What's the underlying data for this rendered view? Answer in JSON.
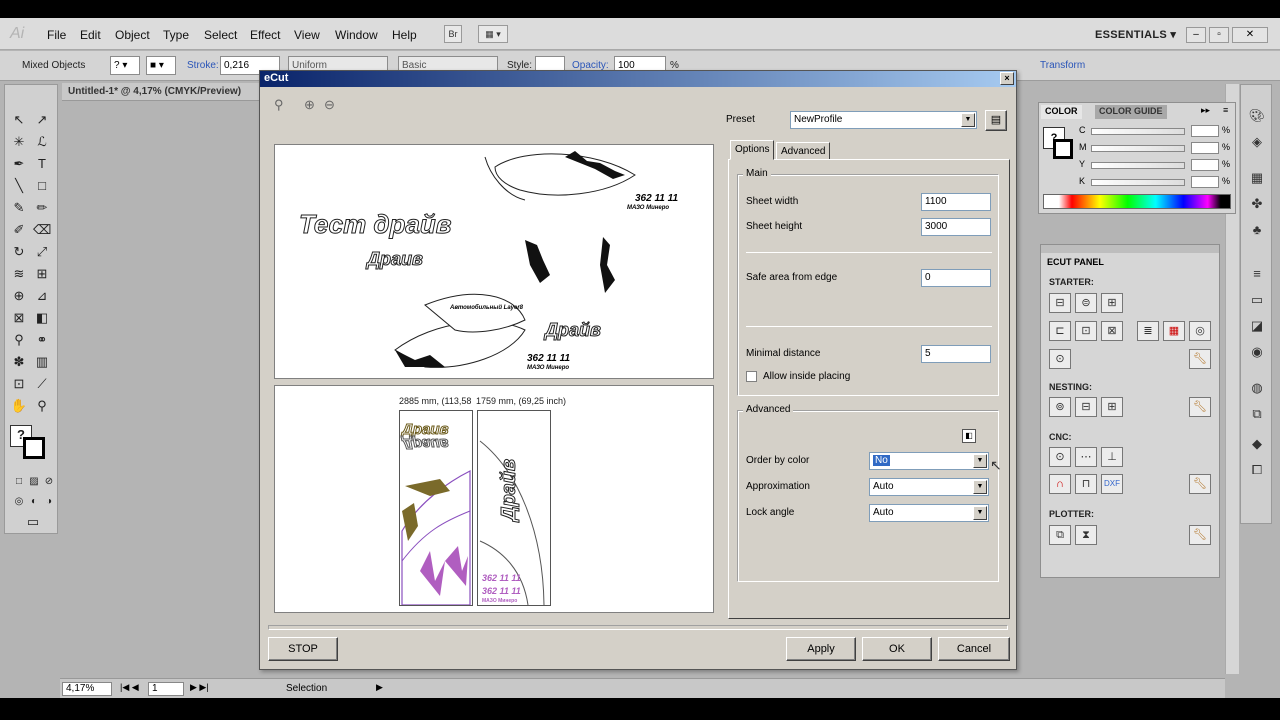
{
  "menubar": {
    "logo": "Ai",
    "items": [
      "File",
      "Edit",
      "Object",
      "Type",
      "Select",
      "Effect",
      "View",
      "Window",
      "Help"
    ],
    "bridge_label": "Br",
    "workspace": "ESSENTIALS"
  },
  "controlbar": {
    "selection": "Mixed Objects",
    "stroke_label": "Stroke:",
    "stroke_value": "0,216",
    "uniform_label": "Uniform",
    "basic_label": "Basic",
    "style_label": "Style:",
    "opacity_label": "Opacity:",
    "opacity_value": "100",
    "opacity_unit": "%",
    "transform_label": "Transform"
  },
  "document": {
    "tab_title": "Untitled-1* @ 4,17% (CMYK/Preview)"
  },
  "statusbar": {
    "zoom": "4,17%",
    "artboard": "1",
    "mode": "Selection"
  },
  "color_panel": {
    "tab_color": "COLOR",
    "tab_guide": "COLOR GUIDE",
    "channels": [
      "C",
      "M",
      "Y",
      "K"
    ],
    "percent": "%"
  },
  "ecut_panel": {
    "title": "ECUT PANEL",
    "starter": "STARTER:",
    "nesting": "NESTING:",
    "cnc": "CNC:",
    "plotter": "PLOTTER:"
  },
  "dialog": {
    "title": "eCut",
    "close": "×",
    "preset_label": "Preset",
    "preset_value": "NewProfile",
    "tabs": [
      "Options",
      "Advanced"
    ],
    "main_group": "Main",
    "sheet_width_label": "Sheet width",
    "sheet_width": "1100",
    "sheet_height_label": "Sheet height",
    "sheet_height": "3000",
    "safe_area_label": "Safe area from edge",
    "safe_area": "0",
    "min_distance_label": "Minimal distance",
    "min_distance": "5",
    "allow_inside_label": "Allow inside placing",
    "advanced_group": "Advanced",
    "order_by_color_label": "Order by color",
    "order_by_color": "No",
    "approximation_label": "Approximation",
    "approximation": "Auto",
    "lock_angle_label": "Lock angle",
    "lock_angle": "Auto",
    "stop": "STOP",
    "apply": "Apply",
    "ok": "OK",
    "cancel": "Cancel",
    "sheet1_dim": "2885 mm, (113,58",
    "sheet2_dim": "1759 mm, (69,25 inch)"
  },
  "artwork": {
    "text1": "Тест драйв",
    "text2": "Драив",
    "text3": "Драйв",
    "phone": "362 11 11",
    "small_caption": "МАЗО Минеро",
    "small_caption_2": "Автомобильный Layer8"
  }
}
